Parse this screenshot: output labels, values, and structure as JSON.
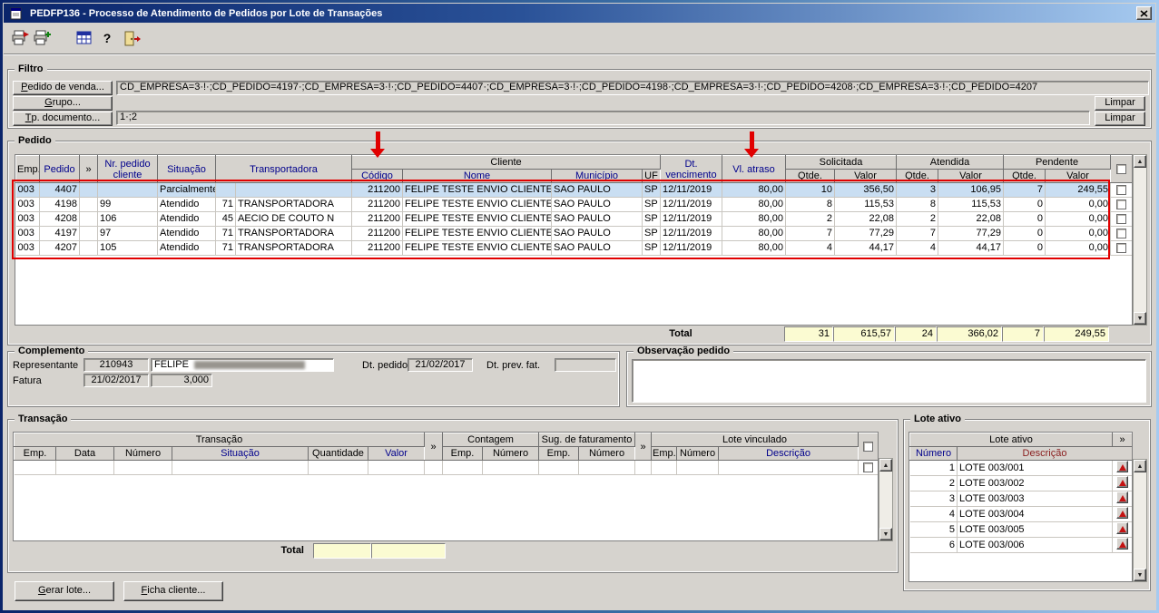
{
  "window": {
    "title": "PEDFP136 - Processo de Atendimento de Pedidos por Lote de Transações"
  },
  "toolbar": {
    "icons": [
      "print-icon",
      "print-batch-icon",
      "grid-icon",
      "help-icon",
      "exit-icon"
    ],
    "help_glyph": "?"
  },
  "filtro": {
    "title": "Filtro",
    "pedido_venda_button": "Pedido de venda...",
    "grupo_button": "Grupo...",
    "tp_documento_button": "Tp. documento...",
    "pedido_venda_value": "CD_EMPRESA=3·!·;CD_PEDIDO=4197·;CD_EMPRESA=3·!·;CD_PEDIDO=4407·;CD_EMPRESA=3·!·;CD_PEDIDO=4198·;CD_EMPRESA=3·!·;CD_PEDIDO=4208·;CD_EMPRESA=3·!·;CD_PEDIDO=4207",
    "tp_documento_value": "1·;2",
    "limpar_button_1": "Limpar",
    "limpar_button_2": "Limpar"
  },
  "pedido": {
    "title": "Pedido",
    "headers": {
      "emp": "Emp.",
      "pedido": "Pedido",
      "chev": "»",
      "nr_pedido_cliente": "Nr. pedido cliente",
      "situacao": "Situação",
      "transportadora": "Transportadora",
      "cliente": "Cliente",
      "codigo": "Código",
      "nome": "Nome",
      "municipio": "Município",
      "uf": "UF",
      "dt_vencimento": "Dt. vencimento",
      "vl_atraso": "Vl. atraso",
      "solicitada": "Solicitada",
      "atendida": "Atendida",
      "pendente": "Pendente",
      "qtde": "Qtde.",
      "valor": "Valor"
    },
    "selected_index": 0,
    "rows": [
      {
        "emp": "003",
        "pedido": "4407",
        "chev": "",
        "nr": "",
        "situacao": "Parcialmente.",
        "tcod": "",
        "tnome": "",
        "codigo": "211200",
        "nome": "FELIPE TESTE ENVIO CLIENTE",
        "municipio": "SAO PAULO",
        "uf": "SP",
        "dt": "12/11/2019",
        "atraso": "80,00",
        "sq": "10",
        "sv": "356,50",
        "aq": "3",
        "av": "106,95",
        "pq": "7",
        "pv": "249,55"
      },
      {
        "emp": "003",
        "pedido": "4198",
        "chev": "",
        "nr": "99",
        "situacao": "Atendido",
        "tcod": "71",
        "tnome": "TRANSPORTADORA",
        "codigo": "211200",
        "nome": "FELIPE TESTE ENVIO CLIENTE",
        "municipio": "SAO PAULO",
        "uf": "SP",
        "dt": "12/11/2019",
        "atraso": "80,00",
        "sq": "8",
        "sv": "115,53",
        "aq": "8",
        "av": "115,53",
        "pq": "0",
        "pv": "0,00"
      },
      {
        "emp": "003",
        "pedido": "4208",
        "chev": "",
        "nr": "106",
        "situacao": "Atendido",
        "tcod": "45",
        "tnome": "AECIO DE COUTO N",
        "codigo": "211200",
        "nome": "FELIPE TESTE ENVIO CLIENTE",
        "municipio": "SAO PAULO",
        "uf": "SP",
        "dt": "12/11/2019",
        "atraso": "80,00",
        "sq": "2",
        "sv": "22,08",
        "aq": "2",
        "av": "22,08",
        "pq": "0",
        "pv": "0,00"
      },
      {
        "emp": "003",
        "pedido": "4197",
        "chev": "",
        "nr": "97",
        "situacao": "Atendido",
        "tcod": "71",
        "tnome": "TRANSPORTADORA",
        "codigo": "211200",
        "nome": "FELIPE TESTE ENVIO CLIENTE",
        "municipio": "SAO PAULO",
        "uf": "SP",
        "dt": "12/11/2019",
        "atraso": "80,00",
        "sq": "7",
        "sv": "77,29",
        "aq": "7",
        "av": "77,29",
        "pq": "0",
        "pv": "0,00"
      },
      {
        "emp": "003",
        "pedido": "4207",
        "chev": "",
        "nr": "105",
        "situacao": "Atendido",
        "tcod": "71",
        "tnome": "TRANSPORTADORA",
        "codigo": "211200",
        "nome": "FELIPE TESTE ENVIO CLIENTE",
        "municipio": "SAO PAULO",
        "uf": "SP",
        "dt": "12/11/2019",
        "atraso": "80,00",
        "sq": "4",
        "sv": "44,17",
        "aq": "4",
        "av": "44,17",
        "pq": "0",
        "pv": "0,00"
      }
    ],
    "total_label": "Total",
    "totals": {
      "sol_qtde": "31",
      "sol_valor": "615,57",
      "ate_qtde": "24",
      "ate_valor": "366,02",
      "pen_qtde": "7",
      "pen_valor": "249,55"
    }
  },
  "complemento": {
    "title": "Complemento",
    "representante_label": "Representante",
    "representante_codigo": "210943",
    "representante_nome": "FELIPE",
    "dt_pedido_label": "Dt. pedido",
    "dt_pedido_value": "21/02/2017",
    "dt_prev_fat_label": "Dt. prev. fat.",
    "dt_prev_fat_value": "",
    "fatura_label": "Fatura",
    "fatura_data": "21/02/2017",
    "fatura_valor": "3,000"
  },
  "observacao": {
    "title": "Observação pedido",
    "text": ""
  },
  "transacao": {
    "title": "Transação",
    "group_transacao": "Transação",
    "group_contagem": "Contagem",
    "group_sug": "Sug. de faturamento",
    "group_lote": "Lote vinculado",
    "headers": {
      "emp": "Emp.",
      "data": "Data",
      "numero": "Número",
      "situacao": "Situação",
      "quantidade": "Quantidade",
      "valor": "Valor",
      "chev": "»",
      "c_emp": "Emp.",
      "c_numero": "Número",
      "s_emp": "Emp.",
      "s_numero": "Número",
      "chev2": "»",
      "l_emp": "Emp.",
      "l_numero": "Número",
      "l_descricao": "Descrição"
    },
    "rows": [
      {}
    ],
    "total_label": "Total",
    "totals": {
      "quantidade": "",
      "valor": ""
    }
  },
  "lote_ativo": {
    "title": "Lote ativo",
    "header_group": "Lote ativo",
    "chev": "»",
    "col_numero": "Número",
    "col_descricao": "Descrição",
    "rows": [
      {
        "numero": "1",
        "descricao": "LOTE 003/001"
      },
      {
        "numero": "2",
        "descricao": "LOTE 003/002"
      },
      {
        "numero": "3",
        "descricao": "LOTE 003/003"
      },
      {
        "numero": "4",
        "descricao": "LOTE 003/004"
      },
      {
        "numero": "5",
        "descricao": "LOTE 003/005"
      },
      {
        "numero": "6",
        "descricao": "LOTE 003/006"
      }
    ]
  },
  "footer": {
    "gerar_lote_button": "Gerar lote...",
    "ficha_cliente_button": "Ficha cliente..."
  },
  "annotations": {
    "color": "#e10000",
    "arrow_1_target": "Código",
    "arrow_2_target": "Vl. atraso",
    "box_target": "pedido-data-rows"
  }
}
